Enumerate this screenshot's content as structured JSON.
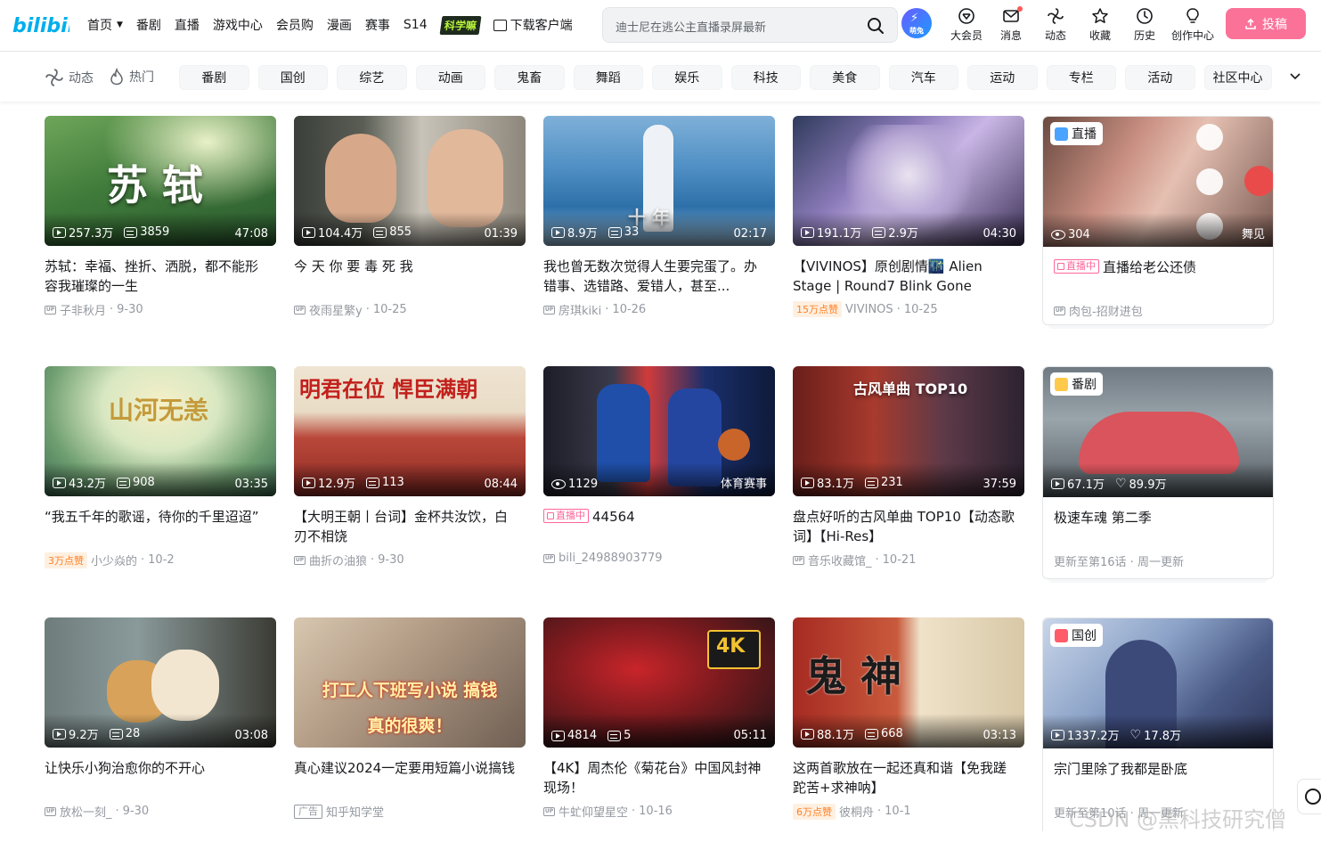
{
  "header": {
    "logo_text": "bilibili",
    "nav_left": [
      {
        "label": "首页",
        "has_dropdown": true
      },
      {
        "label": "番剧"
      },
      {
        "label": "直播"
      },
      {
        "label": "游戏中心"
      },
      {
        "label": "会员购"
      },
      {
        "label": "漫画"
      },
      {
        "label": "赛事"
      },
      {
        "label": "S14"
      },
      {
        "label": "科学嘛",
        "style": "promo"
      },
      {
        "label": "下载客户端",
        "icon": "download-icon"
      }
    ],
    "search_placeholder": "迪士尼在逃公主直播录屏最新",
    "avatar_badge": "萌兔",
    "nav_right": [
      {
        "label": "大会员",
        "icon": "vip-icon"
      },
      {
        "label": "消息",
        "icon": "message-icon",
        "dot": true
      },
      {
        "label": "动态",
        "icon": "dynamic-icon"
      },
      {
        "label": "收藏",
        "icon": "star-icon"
      },
      {
        "label": "历史",
        "icon": "clock-icon"
      },
      {
        "label": "创作中心",
        "icon": "bulb-icon"
      }
    ],
    "upload_label": "投稿",
    "accent_color": "#fb7299",
    "brand_color": "#00aeec"
  },
  "channels": {
    "dynamic_label": "动态",
    "hot_label": "热门",
    "tags": [
      "番剧",
      "国创",
      "综艺",
      "动画",
      "鬼畜",
      "舞蹈",
      "娱乐",
      "科技",
      "美食",
      "汽车",
      "运动",
      "专栏",
      "活动",
      "社区中心"
    ]
  },
  "cards": [
    {
      "type": "video",
      "overlay": "苏 轼",
      "views": "257.3万",
      "danmaku": "3859",
      "duration": "47:08",
      "title": "苏轼：幸福、挫折、洒脱，都不能形容我璀璨的一生",
      "author": "子非秋月",
      "date": "9-30"
    },
    {
      "type": "video",
      "overlay": "",
      "views": "104.4万",
      "danmaku": "855",
      "duration": "01:39",
      "title": "今 天 你 要 毒 死 我",
      "author": "夜雨星繁y",
      "date": "10-25"
    },
    {
      "type": "video",
      "overlay": "十 年",
      "views": "8.9万",
      "danmaku": "33",
      "duration": "02:17",
      "title": "我也曾无数次觉得人生要完蛋了。办错事、选错路、爱错人，甚至...",
      "author": "房琪kiki",
      "date": "10-26"
    },
    {
      "type": "video",
      "overlay": "",
      "views": "191.1万",
      "danmaku": "2.9万",
      "duration": "04:30",
      "title": "【VIVINOS】原创剧情🌃 Alien Stage | Round7 Blink Gone",
      "hot": "15万点赞",
      "author": "VIVINOS",
      "date": "10-25"
    },
    {
      "type": "live",
      "badge": "直播",
      "viewers": "304",
      "corner": "舞见",
      "live_tag": "直播中",
      "title": "直播给老公还债",
      "author": "肉包-招财进包"
    },
    {
      "type": "video",
      "overlay": "山河无恙",
      "views": "43.2万",
      "danmaku": "908",
      "duration": "03:35",
      "title": "“我五千年的歌谣，待你的千里迢迢”",
      "hot": "3万点赞",
      "author": "小少焱的",
      "date": "10-2"
    },
    {
      "type": "video",
      "overlay": "明君在位 悍臣满朝",
      "views": "12.9万",
      "danmaku": "113",
      "duration": "08:44",
      "title": "【大明王朝丨台词】金杯共汝饮，白刃不相饶",
      "author": "曲折の油狼",
      "date": "9-30"
    },
    {
      "type": "livecard",
      "viewers": "1129",
      "corner": "体育赛事",
      "live_tag": "直播中",
      "title": "44564",
      "author": "bili_24988903779"
    },
    {
      "type": "video",
      "overlay": "古风单曲 TOP10",
      "views": "83.1万",
      "danmaku": "231",
      "duration": "37:59",
      "title": "盘点好听的古风单曲 TOP10【动态歌词】【Hi-Res】",
      "author": "音乐收藏馆_",
      "date": "10-21"
    },
    {
      "type": "bangumi",
      "badge": "番剧",
      "views": "67.1万",
      "likes": "89.9万",
      "title": "极速车魂 第二季",
      "update": "更新至第16话 · 周一更新"
    },
    {
      "type": "video",
      "overlay": "",
      "views": "9.2万",
      "danmaku": "28",
      "duration": "03:08",
      "title": "让快乐小狗治愈你的不开心",
      "author": "放松一刻_",
      "date": "9-30"
    },
    {
      "type": "ad",
      "overlay": "打工人下班写小说 搞钱真的很爽！",
      "title": "真心建议2024一定要用短篇小说搞钱",
      "ad_label": "广告",
      "author": "知乎知学堂"
    },
    {
      "type": "video",
      "overlay": "4K",
      "views": "4814",
      "danmaku": "5",
      "duration": "05:11",
      "title": "【4K】周杰伦《菊花台》中国风封神现场！",
      "author": "牛虻仰望星空",
      "date": "10-16"
    },
    {
      "type": "video",
      "overlay": "鬼 神",
      "views": "88.1万",
      "danmaku": "668",
      "duration": "03:13",
      "title": "这两首歌放在一起还真和谐【免我蹉跎苦+求神呐】",
      "hot": "6万点赞",
      "author": "彼桐舟",
      "date": "10-1"
    },
    {
      "type": "bangumi",
      "badge": "国创",
      "views": "1337.2万",
      "likes": "17.8万",
      "title": "宗门里除了我都是卧底",
      "update": "更新至第10话 · 周一更新"
    }
  ],
  "watermark": "CSDN @黑科技研究僧"
}
